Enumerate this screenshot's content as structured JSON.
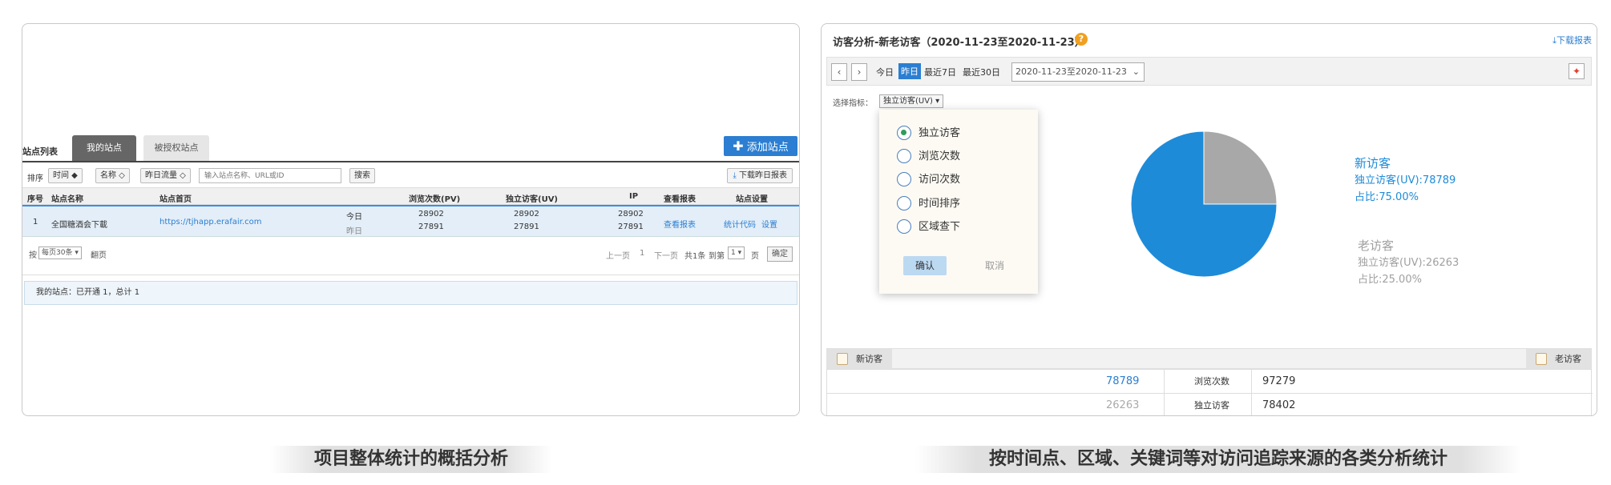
{
  "left": {
    "section_title": "站点列表",
    "tabs": [
      {
        "label": "我的站点"
      },
      {
        "label": "被授权站点"
      }
    ],
    "add_button": "添加站点",
    "filter": {
      "sort_label": "排序",
      "sort_buttons": [
        "时间 ◆",
        "名称 ◇",
        "昨日流量 ◇"
      ],
      "search_placeholder": "输入站点名称、URL或ID",
      "search_button": "搜索",
      "download_button": "下载昨日报表"
    },
    "table": {
      "headers": [
        "序号",
        "站点名称",
        "站点首页",
        "浏览次数(PV)",
        "独立访客(UV)",
        "IP",
        "查看报表",
        "站点设置"
      ],
      "row": {
        "index": "1",
        "name": "全国糖酒会下載",
        "url": "https://tjhapp.erafair.com",
        "today_label": "今日",
        "yesterday_label": "昨日",
        "pv_today": "28902",
        "pv_yesterday": "27891",
        "uv_today": "28902",
        "uv_yesterday": "27891",
        "ip_today": "28902",
        "ip_yesterday": "27891",
        "report_link": "查看报表",
        "code_link": "统计代码",
        "settings_link": "设置"
      }
    },
    "pager": {
      "per_page_prefix": "按",
      "per_page_value": "每页30条 ▾",
      "per_page_suffix": "翻页",
      "prev": "上一页",
      "current": "1",
      "next": "下一页",
      "total": "共1条",
      "goto_label": "到第",
      "goto_value": "1 ▾",
      "page_unit": "页",
      "confirm": "确定"
    },
    "summary": "我的站点：已开通 1，总计 1"
  },
  "right": {
    "title": "访客分析-新老访客（2020-11-23至2020-11-23）",
    "help_icon": "?",
    "download_report": "下载报表",
    "ranges": [
      "今日",
      "昨日",
      "最近7日",
      "最近30日"
    ],
    "active_range": "昨日",
    "date_value": "2020-11-23至2020-11-23",
    "metric_label": "选择指标：",
    "metric_value": "独立访客(UV) ▾",
    "popup": {
      "options": [
        "独立访客",
        "浏览次数",
        "访问次数",
        "时间排序",
        "区域查下"
      ],
      "selected": "独立访客",
      "ok": "确认",
      "cancel": "取消"
    },
    "chart_data": {
      "type": "pie",
      "slices": [
        {
          "name": "新访客",
          "value": 78789,
          "percent": 75.0,
          "color": "#1e8bd8"
        },
        {
          "name": "老访客",
          "value": 26263,
          "percent": 25.0,
          "color": "#a8a8a8"
        }
      ]
    },
    "legend": {
      "new": {
        "title": "新访客",
        "uv": "独立访客(UV):78789",
        "ratio": "占比:75.00%"
      },
      "old": {
        "title": "老访客",
        "uv": "独立访客(UV):26263",
        "ratio": "占比:25.00%"
      }
    },
    "bottom_tabs": {
      "new": "新访客",
      "old": "老访客"
    },
    "stats": [
      {
        "value": "78789",
        "label": "浏览次数",
        "number": "97279"
      },
      {
        "value": "26263",
        "label": "独立访客",
        "number": "78402"
      }
    ]
  },
  "captions": {
    "left": "项目整体统计的概括分析",
    "right": "按时间点、区域、关键词等对访问追踪来源的各类分析统计"
  },
  "colors": {
    "accent": "#2b7ed1",
    "pie_new": "#1e8bd8",
    "pie_old": "#a8a8a8"
  }
}
